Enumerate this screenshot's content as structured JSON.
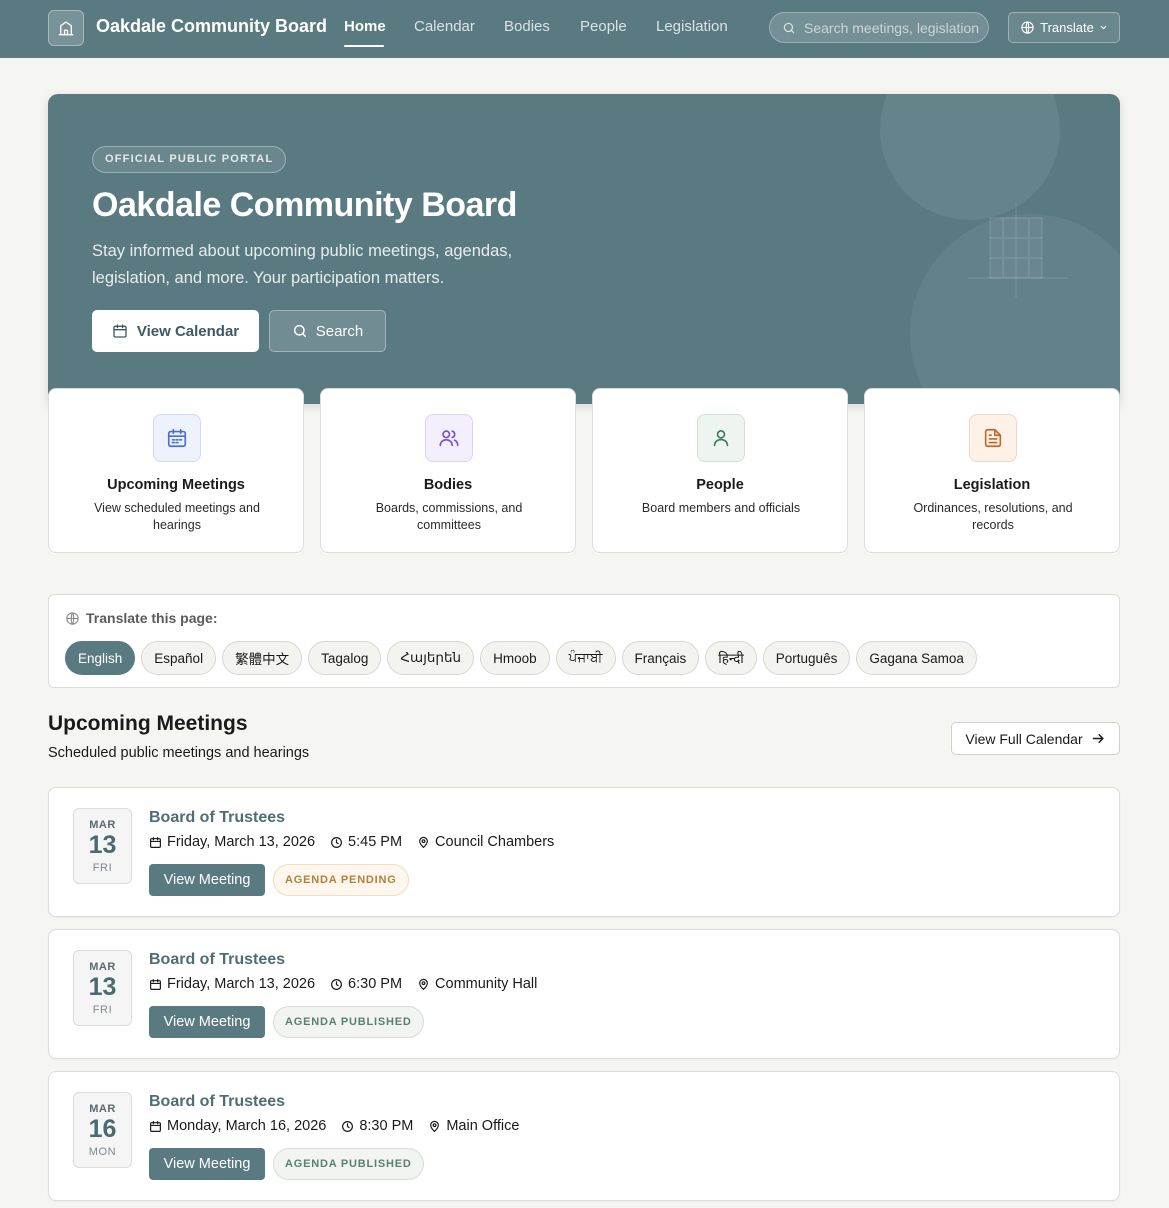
{
  "header": {
    "brand": "Oakdale Community Board",
    "nav": [
      "Home",
      "Calendar",
      "Bodies",
      "People",
      "Legislation"
    ],
    "search_placeholder": "Search meetings, legislation...",
    "translate_label": "Translate"
  },
  "hero": {
    "badge": "OFFICIAL PUBLIC PORTAL",
    "title": "Oakdale Community Board",
    "subtitle": "Stay informed about upcoming public meetings, agendas, legislation, and more. Your participation matters.",
    "primary_button": "View Calendar",
    "secondary_button": "Search"
  },
  "cards": [
    {
      "title": "Upcoming Meetings",
      "desc": "View scheduled meetings and hearings",
      "icon": "calendar-icon",
      "color": "#4a6fd4"
    },
    {
      "title": "Bodies",
      "desc": "Boards, commissions, and committees",
      "icon": "users-icon",
      "color": "#7a4fd0"
    },
    {
      "title": "People",
      "desc": "Board members and officials",
      "icon": "user-icon",
      "color": "#3f7a5a"
    },
    {
      "title": "Legislation",
      "desc": "Ordinances, resolutions, and records",
      "icon": "document-icon",
      "color": "#c06a2a"
    }
  ],
  "translate": {
    "label": "Translate this page:",
    "languages": [
      "English",
      "Español",
      "繁體中文",
      "Tagalog",
      "Հայերեն",
      "Hmoob",
      "ਪੰਜਾਬੀ",
      "Français",
      "हिन्दी",
      "Português",
      "Gagana Samoa"
    ],
    "active": "English"
  },
  "section": {
    "title": "Upcoming Meetings",
    "subtitle": "Scheduled public meetings and hearings",
    "view_all": "View Full Calendar"
  },
  "meetings": [
    {
      "month": "MAR",
      "day": "13",
      "dow": "FRI",
      "body": "Board of Trustees",
      "date": "Friday, March 13, 2026",
      "time": "5:45 PM",
      "location": "Council Chambers",
      "button": "View Meeting",
      "status": "AGENDA PENDING"
    },
    {
      "month": "MAR",
      "day": "13",
      "dow": "FRI",
      "body": "Board of Trustees",
      "date": "Friday, March 13, 2026",
      "time": "6:30 PM",
      "location": "Community Hall",
      "button": "View Meeting",
      "status": "AGENDA PUBLISHED"
    },
    {
      "month": "MAR",
      "day": "16",
      "dow": "MON",
      "body": "Board of Trustees",
      "date": "Monday, March 16, 2026",
      "time": "8:30 PM",
      "location": "Main Office",
      "button": "View Meeting",
      "status": "AGENDA PUBLISHED"
    }
  ],
  "colors": {
    "primary": "#5a7a82",
    "background": "#f5f5f2",
    "pending": "#b5813a",
    "published": "#5a8070"
  }
}
